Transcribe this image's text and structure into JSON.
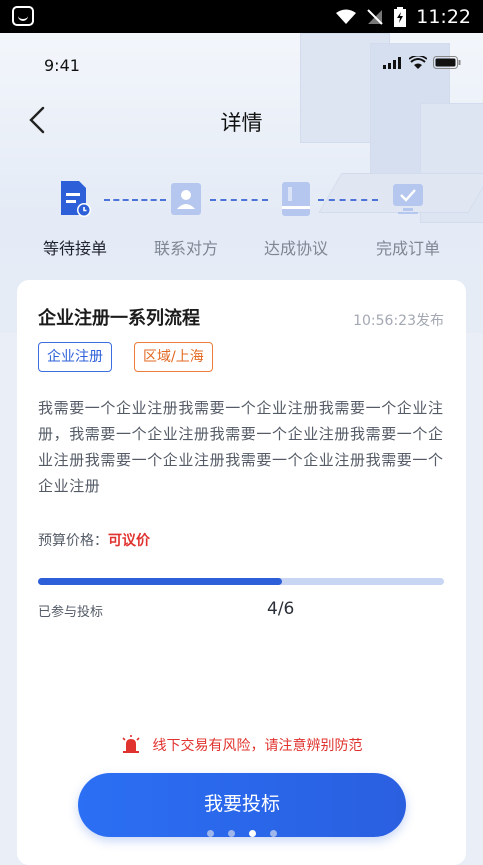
{
  "android_status": {
    "time": "11:22"
  },
  "ios_status": {
    "time": "9:41"
  },
  "nav": {
    "title": "详情"
  },
  "steps": [
    {
      "label": "等待接单",
      "icon": "document-clock-icon",
      "active": true
    },
    {
      "label": "联系对方",
      "icon": "contact-card-icon",
      "active": false
    },
    {
      "label": "达成协议",
      "icon": "agreement-book-icon",
      "active": false
    },
    {
      "label": "完成订单",
      "icon": "monitor-check-icon",
      "active": false
    }
  ],
  "order": {
    "title": "企业注册一系列流程",
    "published_time": "10:56:23发布",
    "tags": [
      "企业注册",
      "区域/上海"
    ],
    "description": "我需要一个企业注册我需要一个企业注册我需要一个企业注册，我需要一个企业注册我需要一个企业注册我需要一个企业注册我需要一个企业注册我需要一个企业注册我需要一个企业注册",
    "budget_label": "预算价格：",
    "budget_value": "可议价",
    "bid_progress": 0.6,
    "joined_label": "已参与投标",
    "bid_count": "4/6"
  },
  "warning": "线下交易有风险，请注意辨别防范",
  "cta_label": "我要投标",
  "pager": {
    "count": 4,
    "active_index": 2
  },
  "colors": {
    "accent": "#2d5fd8",
    "danger": "#e0332f",
    "tag_orange": "#e36a24"
  }
}
